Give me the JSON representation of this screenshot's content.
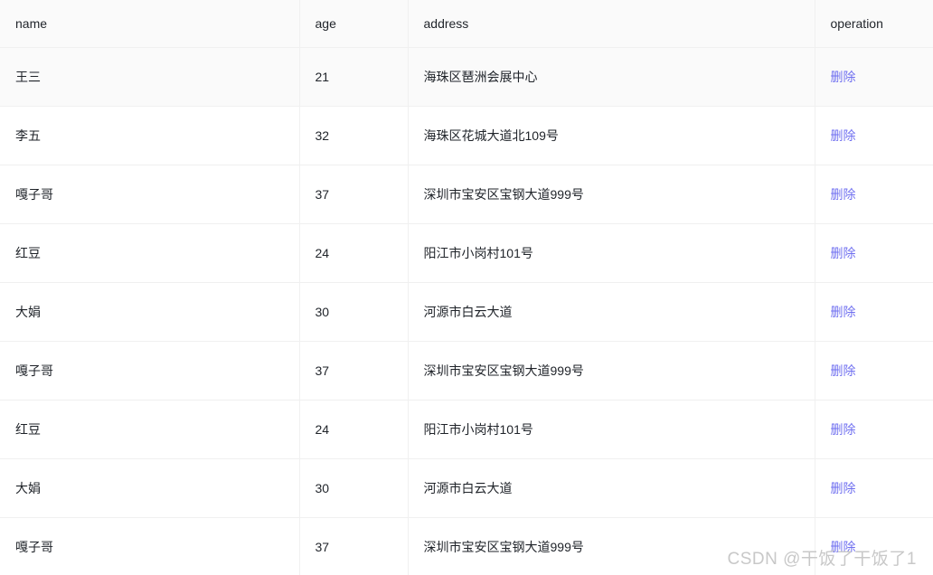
{
  "table": {
    "columns": [
      {
        "key": "name",
        "label": "name"
      },
      {
        "key": "age",
        "label": "age"
      },
      {
        "key": "address",
        "label": "address"
      },
      {
        "key": "operation",
        "label": "operation"
      }
    ],
    "action_label": "删除",
    "rows": [
      {
        "name": "王三",
        "age": "21",
        "address": "海珠区琶洲会展中心",
        "operation": "删除",
        "hovered": true
      },
      {
        "name": "李五",
        "age": "32",
        "address": "海珠区花城大道北109号",
        "operation": "删除",
        "hovered": false
      },
      {
        "name": "嘎子哥",
        "age": "37",
        "address": "深圳市宝安区宝钢大道999号",
        "operation": "删除",
        "hovered": false
      },
      {
        "name": "红豆",
        "age": "24",
        "address": "阳江市小岗村101号",
        "operation": "删除",
        "hovered": false
      },
      {
        "name": "大娟",
        "age": "30",
        "address": "河源市白云大道",
        "operation": "删除",
        "hovered": false
      },
      {
        "name": "嘎子哥",
        "age": "37",
        "address": "深圳市宝安区宝钢大道999号",
        "operation": "删除",
        "hovered": false
      },
      {
        "name": "红豆",
        "age": "24",
        "address": "阳江市小岗村101号",
        "operation": "删除",
        "hovered": false
      },
      {
        "name": "大娟",
        "age": "30",
        "address": "河源市白云大道",
        "operation": "删除",
        "hovered": false
      },
      {
        "name": "嘎子哥",
        "age": "37",
        "address": "深圳市宝安区宝钢大道999号",
        "operation": "删除",
        "hovered": false
      }
    ]
  },
  "watermark": {
    "text": "CSDN @干饭了干饭了1"
  },
  "colors": {
    "header_background": "#fafafa",
    "row_hover_background": "#fafafa",
    "border": "#f0f0f0",
    "text": "#1f2329",
    "link": "#7070f0",
    "watermark": "#c8c8c8"
  }
}
